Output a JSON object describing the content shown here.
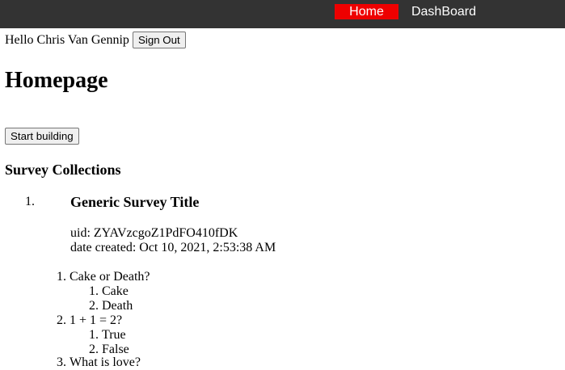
{
  "nav": {
    "home_label": "Home",
    "dashboard_label": "DashBoard",
    "active_color": "#ee0000",
    "bar_color": "#333333"
  },
  "user": {
    "greeting": "Hello Chris Van Gennip",
    "signout_label": "Sign Out"
  },
  "page": {
    "title": "Homepage",
    "start_button_label": "Start building",
    "section_title": "Survey Collections"
  },
  "surveys": [
    {
      "number": "1.",
      "title": "Generic Survey Title",
      "uid_text": "uid: ZYAVzcgoZ1PdFO410fDK",
      "date_text": "date created: Oct 10, 2021, 2:53:38 AM",
      "questions": [
        {
          "number": "1.",
          "text": "Cake or Death?",
          "options": [
            {
              "number": "1.",
              "text": "Cake"
            },
            {
              "number": "2.",
              "text": "Death"
            }
          ]
        },
        {
          "number": "2.",
          "text": "1 + 1 = 2?",
          "options": [
            {
              "number": "1.",
              "text": "True"
            },
            {
              "number": "2.",
              "text": "False"
            }
          ]
        },
        {
          "number": "3.",
          "text": "What is love?",
          "options": []
        }
      ]
    }
  ]
}
